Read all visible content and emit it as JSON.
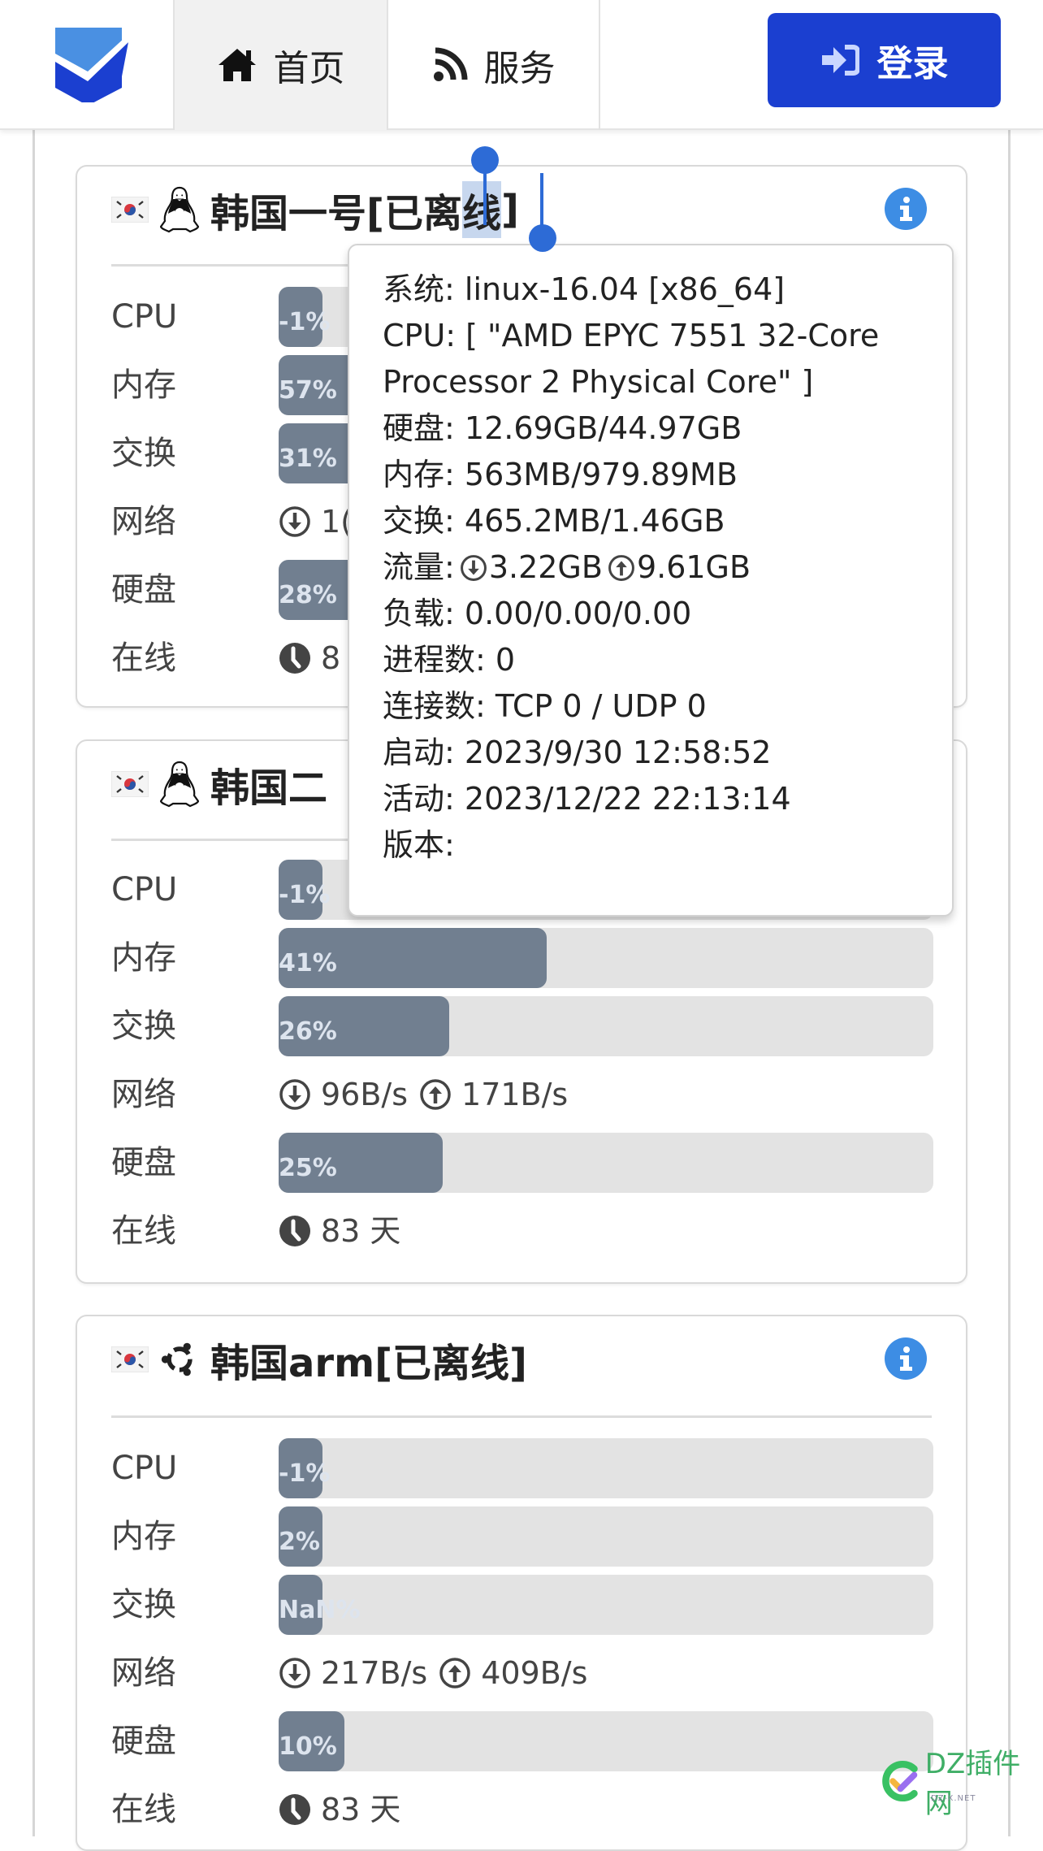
{
  "header": {
    "logo": "shield-check-logo",
    "nav": [
      {
        "icon": "home-icon",
        "label": "首页",
        "active": true
      },
      {
        "icon": "rss-icon",
        "label": "服务",
        "active": false
      }
    ],
    "login": {
      "icon": "sign-in-icon",
      "label": "登录"
    }
  },
  "colors": {
    "brand": "#1b3fd0",
    "info": "#3d8de4",
    "bar_fill": "#717f90",
    "bar_track": "#e3e3e3"
  },
  "row_labels": {
    "cpu": "CPU",
    "mem": "内存",
    "swap": "交换",
    "net": "网络",
    "disk": "硬盘",
    "online": "在线"
  },
  "servers": [
    {
      "flag": "KR",
      "os_icon": "linux-tux-icon",
      "title_prefix": "韩国一号[已离",
      "title_selected": "线",
      "title_suffix": "]",
      "cpu": {
        "text": "-1%",
        "value": -1
      },
      "mem": {
        "text": "57%",
        "value": 57
      },
      "swap": {
        "text": "31%",
        "value": 31
      },
      "net": {
        "down": "1(",
        "up": ""
      },
      "disk": {
        "text": "28%",
        "value": 28
      },
      "online": "8"
    },
    {
      "flag": "KR",
      "os_icon": "linux-tux-icon",
      "title": "韩国二",
      "cpu": {
        "text": "-1%",
        "value": -1
      },
      "mem": {
        "text": "41%",
        "value": 41
      },
      "swap": {
        "text": "26%",
        "value": 26
      },
      "net": {
        "down": "96B/s",
        "up": "171B/s"
      },
      "disk": {
        "text": "25%",
        "value": 25
      },
      "online": "83 天"
    },
    {
      "flag": "KR",
      "os_icon": "ubuntu-icon",
      "title": "韩国arm[已离线]",
      "cpu": {
        "text": "-1%",
        "value": -1
      },
      "mem": {
        "text": "2%",
        "value": 2
      },
      "swap": {
        "text": "NaN%",
        "value": null
      },
      "net": {
        "down": "217B/s",
        "up": "409B/s"
      },
      "disk": {
        "text": "10%",
        "value": 10
      },
      "online": "83 天"
    }
  ],
  "popover": {
    "lines": [
      {
        "key": "系统:",
        "value": " linux-16.04 [x86_64]"
      },
      {
        "key": "CPU:",
        "value": " [ \"AMD EPYC 7551 32-Core"
      },
      {
        "key": "",
        "value": "Processor 2 Physical Core\" ]"
      },
      {
        "key": "硬盘:",
        "value": " 12.69GB/44.97GB"
      },
      {
        "key": "内存:",
        "value": " 563MB/979.89MB"
      },
      {
        "key": "交换:",
        "value": " 465.2MB/1.46GB"
      },
      {
        "key": "流量:",
        "down": "3.22GB",
        "up": "9.61GB"
      },
      {
        "key": "负载:",
        "value": " 0.00/0.00/0.00"
      },
      {
        "key": "进程数:",
        "value": " 0"
      },
      {
        "key": "连接数:",
        "value": " TCP 0 / UDP 0"
      },
      {
        "key": "启动:",
        "value": " 2023/9/30 12:58:52"
      },
      {
        "key": "活动:",
        "value": " 2023/12/22 22:13:14"
      },
      {
        "key": "版本:",
        "value": ""
      }
    ]
  },
  "watermark": {
    "text": "DZ插件网",
    "sub": "DZ-X.NET"
  }
}
